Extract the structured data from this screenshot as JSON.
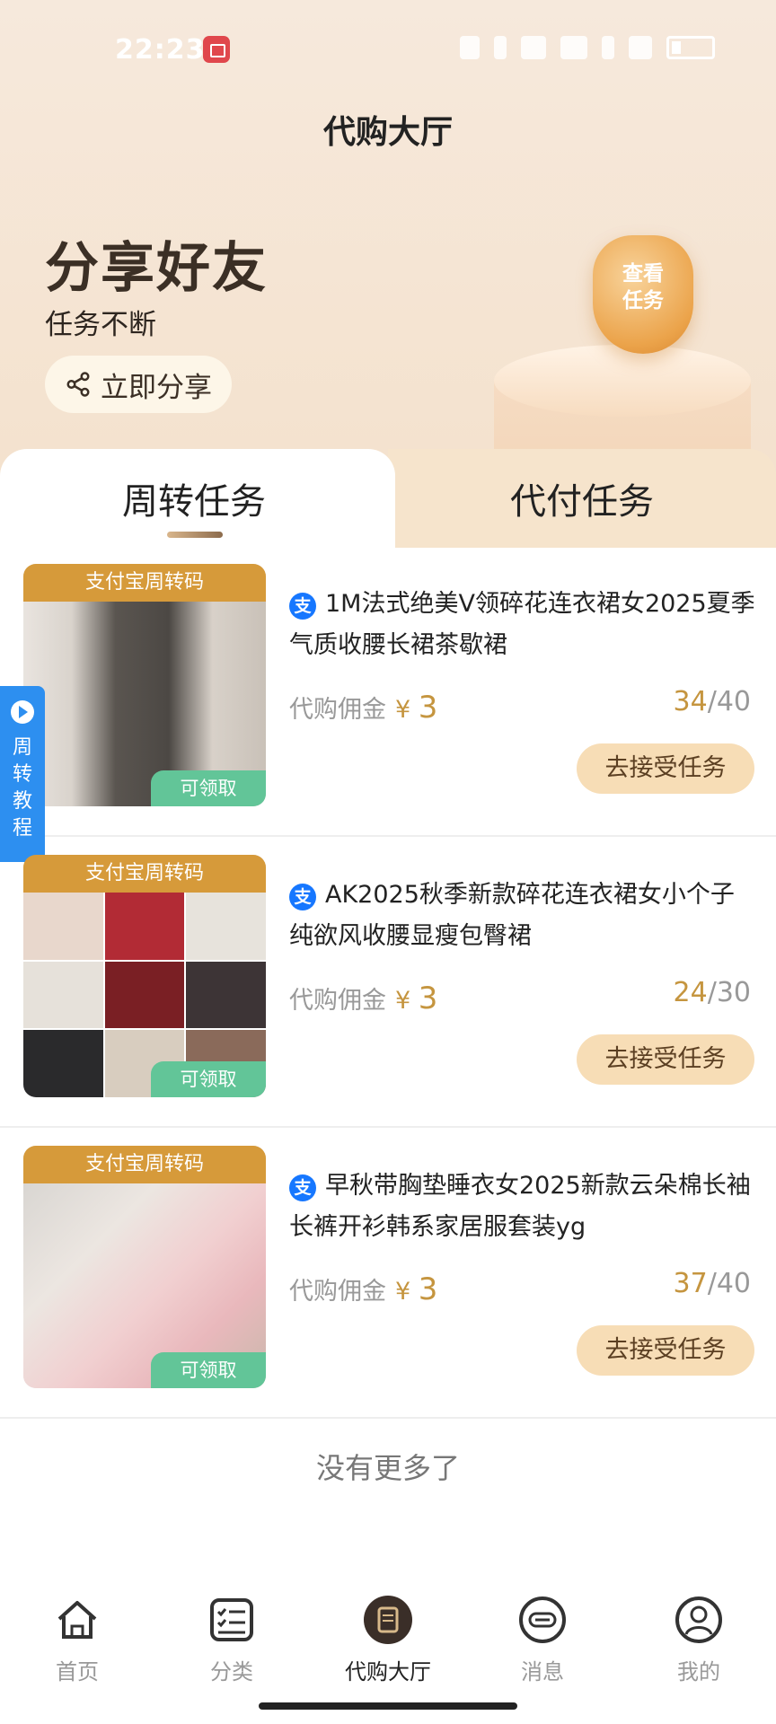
{
  "status": {
    "time": "22:23"
  },
  "header": {
    "title": "代购大厅"
  },
  "hero": {
    "title": "分享好友",
    "subtitle": "任务不断",
    "share_button": "立即分享",
    "badge_text": "查看任务"
  },
  "tabs": [
    {
      "label": "周转任务",
      "active": true
    },
    {
      "label": "代付任务",
      "active": false
    }
  ],
  "side_tab": {
    "label": "周转教程"
  },
  "tasks": [
    {
      "banner": "支付宝周转码",
      "tag": "可领取",
      "title": "1M法式绝美V领碎花连衣裙女2025夏季气质收腰长裙茶歇裙",
      "commission_label": "代购佣金",
      "currency": "¥",
      "commission": "3",
      "done": "34",
      "total": "/40",
      "button": "去接受任务",
      "pay_icon": "支"
    },
    {
      "banner": "支付宝周转码",
      "tag": "可领取",
      "title": "AK2025秋季新款碎花连衣裙女小个子纯欲风收腰显瘦包臀裙",
      "commission_label": "代购佣金",
      "currency": "¥",
      "commission": "3",
      "done": "24",
      "total": "/30",
      "button": "去接受任务",
      "pay_icon": "支"
    },
    {
      "banner": "支付宝周转码",
      "tag": "可领取",
      "title": "早秋带胸垫睡衣女2025新款云朵棉长袖长裤开衫韩系家居服套装yg",
      "commission_label": "代购佣金",
      "currency": "¥",
      "commission": "3",
      "done": "37",
      "total": "/40",
      "button": "去接受任务",
      "pay_icon": "支"
    }
  ],
  "footer_text": "没有更多了",
  "nav": [
    {
      "label": "首页",
      "icon": "home-icon"
    },
    {
      "label": "分类",
      "icon": "category-icon"
    },
    {
      "label": "代购大厅",
      "icon": "hall-icon",
      "active": true
    },
    {
      "label": "消息",
      "icon": "message-icon"
    },
    {
      "label": "我的",
      "icon": "profile-icon"
    }
  ],
  "colors": {
    "accent": "#c5953f",
    "alipay": "#1677ff",
    "tag_green": "#62c598",
    "banner": "#d69a3a",
    "button": "#f7ddb6"
  }
}
